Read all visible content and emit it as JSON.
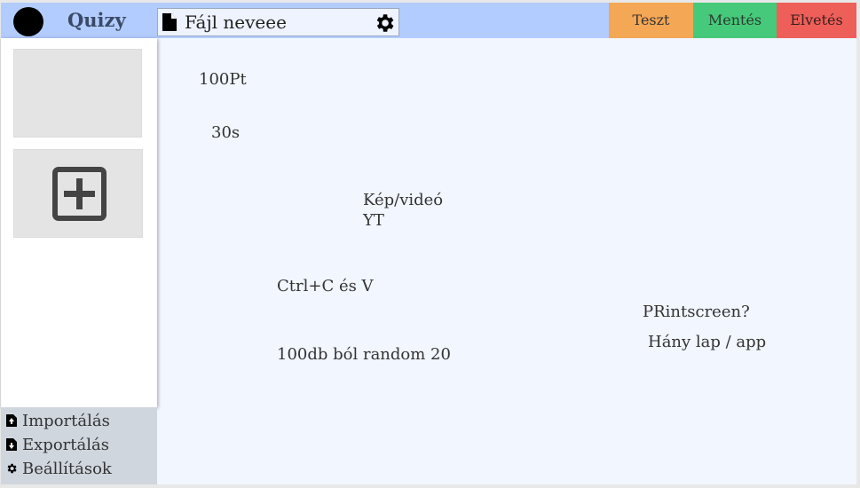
{
  "header": {
    "app_name": "Quizy",
    "file_name": "Fájl neveee",
    "buttons": {
      "test": "Teszt",
      "save": "Mentés",
      "discard": "Elvetés"
    }
  },
  "canvas": {
    "notes": {
      "points": "100Pt",
      "time": "30s",
      "media": "Kép/videó\nYT",
      "copy_paste": "Ctrl+C és V",
      "random": "100db ból random 20",
      "printscreen": "PRintscreen?",
      "pages": "Hány lap / app"
    }
  },
  "sidebar": {
    "menu": {
      "import": "Importálás",
      "export": "Exportálás",
      "settings": "Beállítások"
    }
  },
  "colors": {
    "topbar": "#b3ccff",
    "test": "#f4a755",
    "save": "#46c97a",
    "discard": "#ee5f5a",
    "canvas": "#f2f6ff",
    "sidebar_bottom": "#d0d6de"
  },
  "icons": {
    "logo": "logo-circle-icon",
    "file": "file-icon",
    "settings": "gear-icon",
    "add": "plus-square-icon",
    "import": "file-import-icon",
    "export": "file-export-icon"
  }
}
